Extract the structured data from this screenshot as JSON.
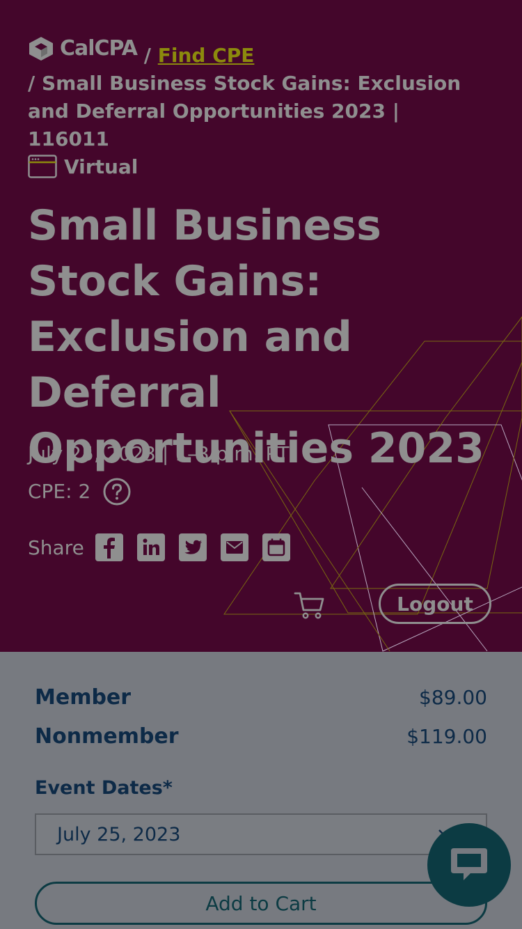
{
  "breadcrumb": {
    "logo_text": "CalCPA",
    "separator": "/",
    "find_cpe": "Find CPE",
    "current": "/ Small Business Stock Gains: Exclusion and Deferral Opportunities 2023 | 116011"
  },
  "event": {
    "format": "Virtual",
    "title": "Small Business Stock Gains: Exclusion and Deferral Opportunities 2023",
    "date_time": "July 25, 2023 | 1–3 p.m. PT",
    "cpe": "CPE: 2"
  },
  "share": {
    "label": "Share",
    "icons": [
      "facebook-icon",
      "linkedin-icon",
      "twitter-icon",
      "email-icon",
      "calendar-icon"
    ]
  },
  "header_actions": {
    "logout": "Logout"
  },
  "pricing": {
    "member_label": "Member",
    "member_price": "$89.00",
    "nonmember_label": "Nonmember",
    "nonmember_price": "$119.00"
  },
  "registration": {
    "dates_label": "Event Dates*",
    "selected_date": "July 25, 2023",
    "add_to_cart": "Add to Cart"
  },
  "colors": {
    "hero_bg": "#44062b",
    "text_muted": "#8f8f8f",
    "link": "#8c8a0d",
    "navy": "#0d2a47",
    "teal": "#0c3b43"
  }
}
